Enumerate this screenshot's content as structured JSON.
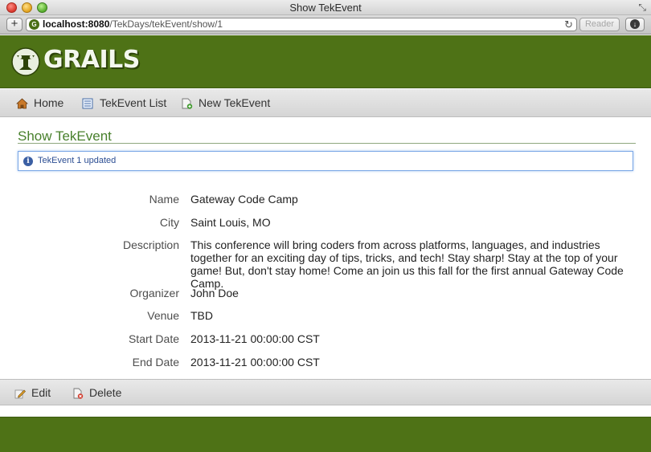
{
  "window": {
    "title": "Show TekEvent"
  },
  "browser": {
    "url_host": "localhost:8080",
    "url_path": "/TekDays/tekEvent/show/1",
    "reader_label": "Reader"
  },
  "header": {
    "logo_text": "GRAILS"
  },
  "nav": {
    "items": [
      {
        "label": "Home",
        "icon": "house-icon"
      },
      {
        "label": "TekEvent List",
        "icon": "list-icon"
      },
      {
        "label": "New TekEvent",
        "icon": "new-document-icon"
      }
    ]
  },
  "page": {
    "title": "Show TekEvent",
    "message": "TekEvent 1 updated"
  },
  "properties": [
    {
      "label": "Name",
      "value": "Gateway Code Camp"
    },
    {
      "label": "City",
      "value": "Saint Louis, MO"
    },
    {
      "label": "Description",
      "value": "This conference will bring coders from across platforms, languages, and industries together for an exciting day of tips, tricks, and tech! Stay sharp! Stay at the top of your game! But, don't stay home! Come an join us this fall for the first annual Gateway Code Camp."
    },
    {
      "label": "Organizer",
      "value": "John Doe"
    },
    {
      "label": "Venue",
      "value": "TBD"
    },
    {
      "label": "Start Date",
      "value": "2013-11-21 00:00:00 CST"
    },
    {
      "label": "End Date",
      "value": "2013-11-21 00:00:00 CST"
    }
  ],
  "actions": {
    "edit_label": "Edit",
    "delete_label": "Delete"
  },
  "colors": {
    "brand_green": "#4e7216",
    "title_green": "#48802c",
    "message_blue": "#2c4e93"
  }
}
